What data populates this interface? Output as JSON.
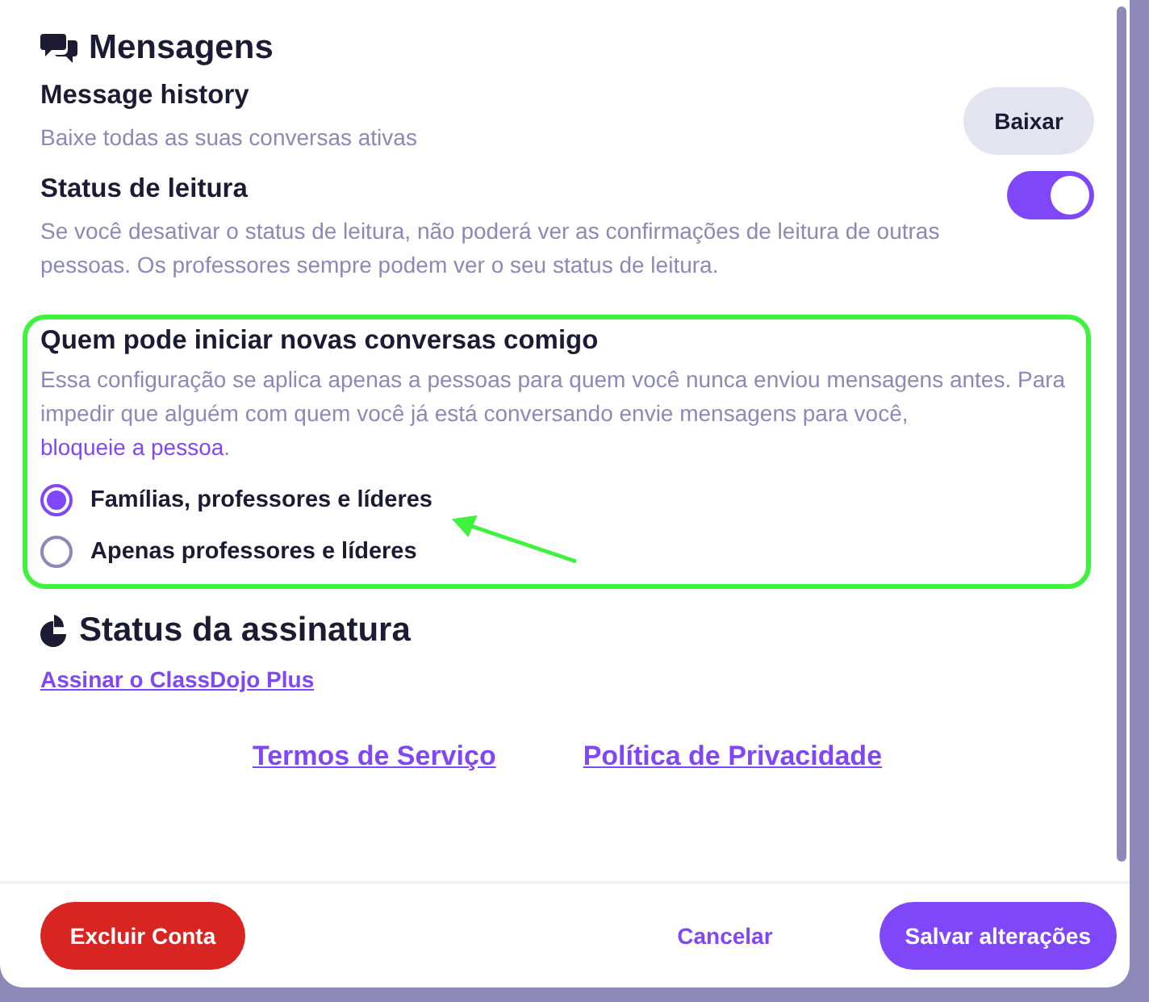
{
  "messages_section": {
    "title": "Mensagens",
    "message_history": {
      "label": "Message history",
      "description": "Baixe todas as suas conversas ativas",
      "button": "Baixar"
    },
    "read_status": {
      "label": "Status de leitura",
      "on": true,
      "description": "Se você desativar o status de leitura, não poderá ver as confirmações de leitura de outras pessoas. Os professores sempre podem ver o seu status de leitura."
    },
    "who_can_start": {
      "label": "Quem pode iniciar novas conversas comigo",
      "description": "Essa configuração se aplica apenas a pessoas para quem você nunca enviou mensagens antes. Para impedir que alguém com quem você já está conversando envie mensagens para você,",
      "link": "bloqueie a pessoa",
      "after_link": ".",
      "options": [
        {
          "label": "Famílias, professores e líderes",
          "selected": true
        },
        {
          "label": "Apenas professores e líderes",
          "selected": false
        }
      ]
    }
  },
  "subscription_section": {
    "title": "Status da assinatura",
    "link": "Assinar o ClassDojo Plus"
  },
  "footer_links": [
    "Termos de Serviço",
    "Política de Privacidade"
  ],
  "buttons": {
    "delete": "Excluir Conta",
    "cancel": "Cancelar",
    "save": "Salvar alterações"
  }
}
